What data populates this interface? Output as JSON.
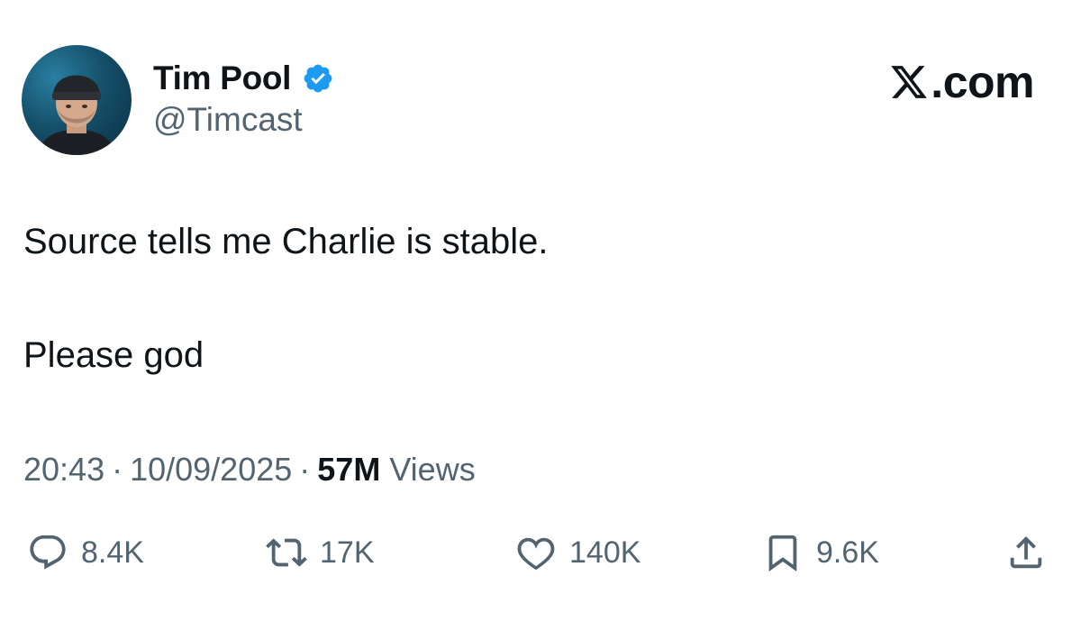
{
  "author": {
    "display_name": "Tim Pool",
    "handle": "@Timcast",
    "verified": true,
    "verified_icon": "verified-badge-icon",
    "verified_color": "#1d9bf0"
  },
  "brand": {
    "label": ".com",
    "logo_icon": "x-logo-icon"
  },
  "tweet": {
    "lines": [
      "Source tells me Charlie is stable.",
      "Please god"
    ]
  },
  "meta": {
    "time": "20:43",
    "separator": "·",
    "date": "10/09/2025",
    "views_count": "57M",
    "views_label": "Views"
  },
  "actions": {
    "reply": {
      "icon": "reply-icon",
      "count": "8.4K"
    },
    "repost": {
      "icon": "repost-icon",
      "count": "17K"
    },
    "like": {
      "icon": "heart-icon",
      "count": "140K"
    },
    "bookmark": {
      "icon": "bookmark-icon",
      "count": "9.6K"
    },
    "share": {
      "icon": "share-icon"
    }
  },
  "colors": {
    "text_primary": "#0f1419",
    "text_secondary": "#536471",
    "background": "#ffffff"
  }
}
